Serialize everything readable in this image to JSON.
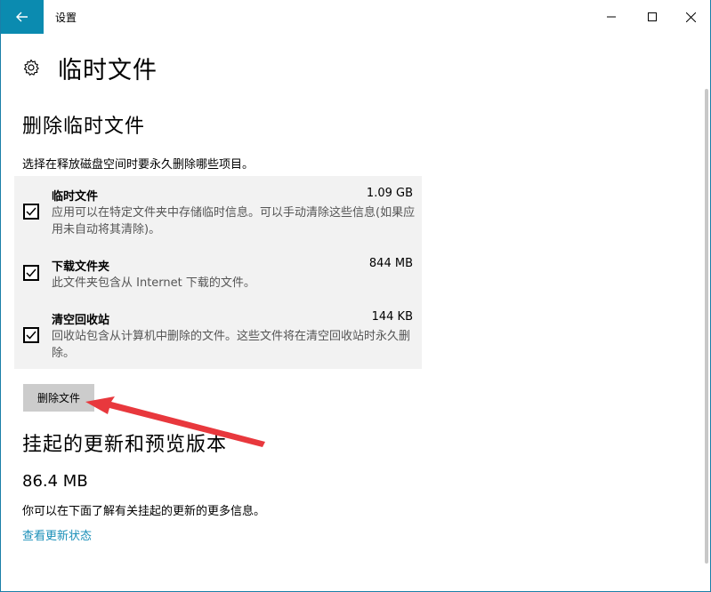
{
  "window": {
    "title": "设置"
  },
  "page": {
    "title": "临时文件"
  },
  "section_delete": {
    "title": "删除临时文件",
    "description": "选择在释放磁盘空间时要永久删除哪些项目。",
    "items": [
      {
        "name": "临时文件",
        "size": "1.09 GB",
        "description": "应用可以在特定文件夹中存储临时信息。可以手动清除这些信息(如果应用未自动将其清除)。",
        "checked": true
      },
      {
        "name": "下载文件夹",
        "size": "844 MB",
        "description": "此文件夹包含从 Internet 下载的文件。",
        "checked": true
      },
      {
        "name": "清空回收站",
        "size": "144 KB",
        "description": "回收站包含从计算机中删除的文件。这些文件将在清空回收站时永久删除。",
        "checked": true
      }
    ],
    "button_label": "删除文件"
  },
  "section_updates": {
    "title": "挂起的更新和预览版本",
    "size": "86.4 MB",
    "info": "你可以在下面了解有关挂起的更新的更多信息。",
    "link": "查看更新状态"
  },
  "colors": {
    "accent": "#0b8bb0",
    "link": "#1a8fb8",
    "annotation_arrow": "#e8383d",
    "panel_bg": "#f2f2f2"
  },
  "icons": {
    "back": "arrow-left-icon",
    "settings": "gear-icon"
  }
}
